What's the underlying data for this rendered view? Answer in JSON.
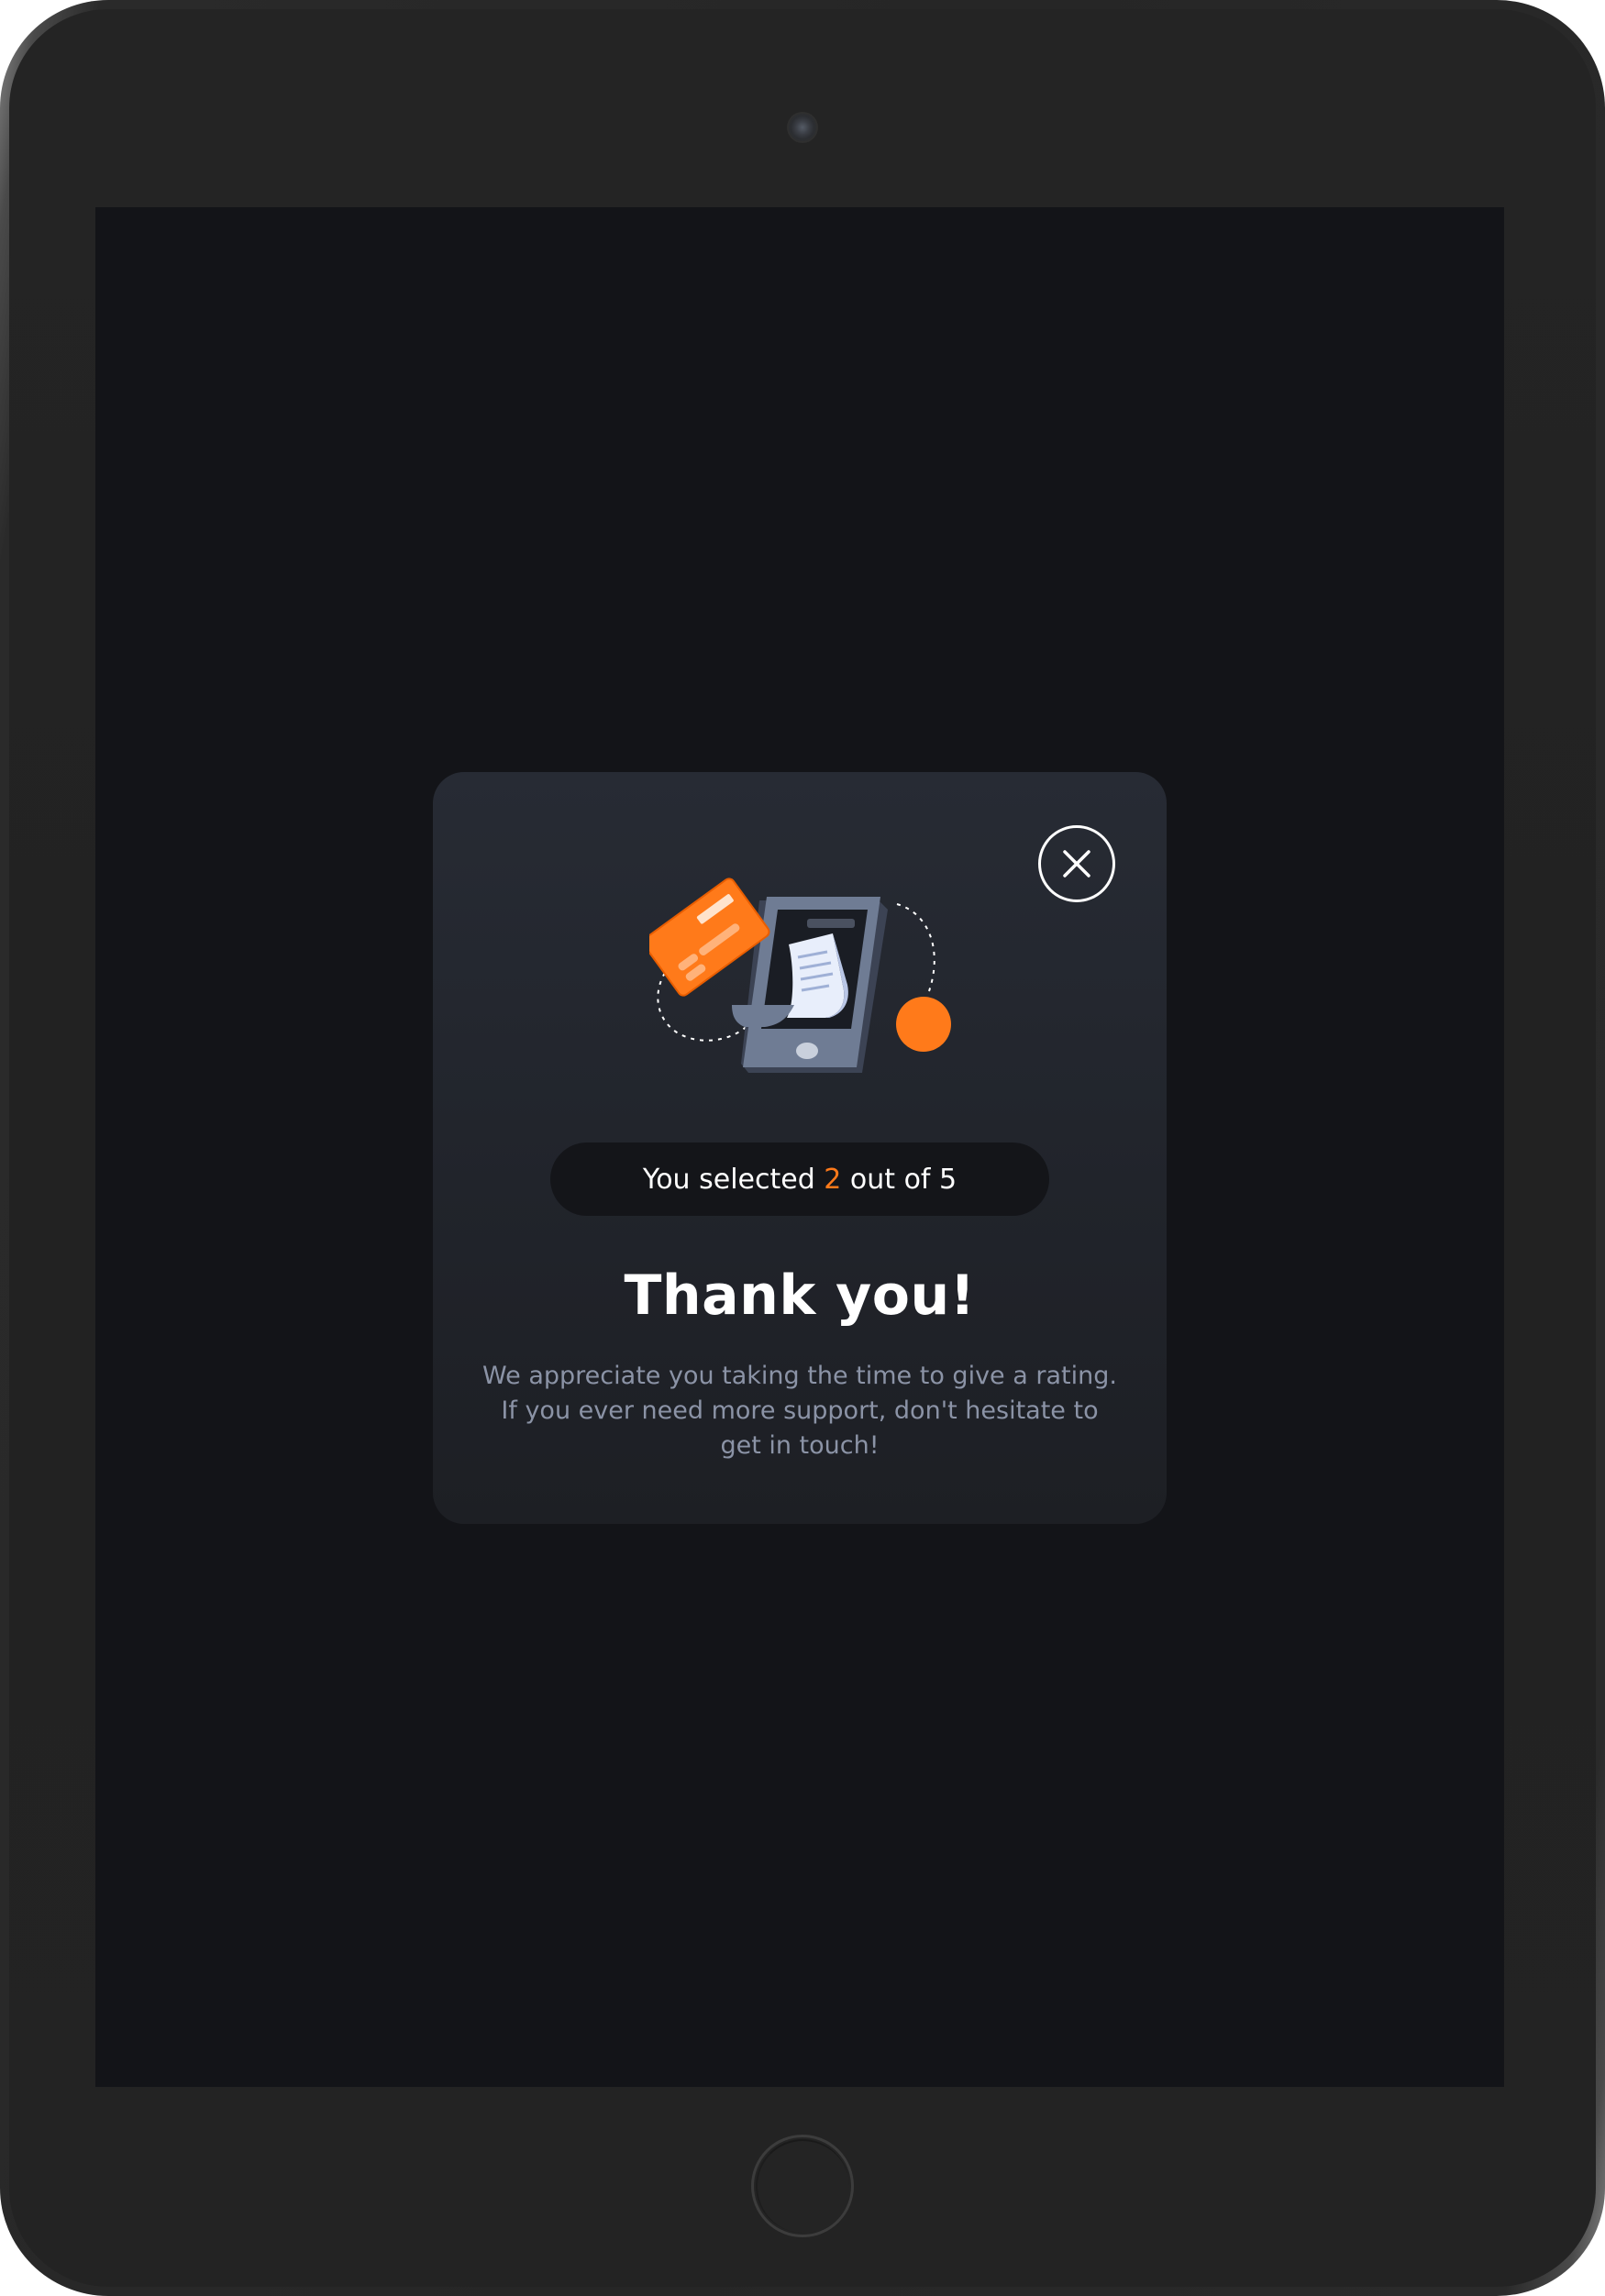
{
  "colors": {
    "accent": "#ff7a1a",
    "screen_background": "#131418",
    "modal_background": "#23262d",
    "pill_background": "#141519",
    "title_text": "#ffffff",
    "body_text": "#8b93a6"
  },
  "modal": {
    "close_icon": "close-icon",
    "illustration_icon": "phone-payment-receipt-illustration",
    "selection": {
      "prefix": "You selected ",
      "value": "2",
      "suffix": " out of 5"
    },
    "title": "Thank you!",
    "message_lines": [
      "We appreciate you taking the time to give a rating.",
      "If you ever need more support, don't hesitate to",
      "get in touch!"
    ]
  }
}
